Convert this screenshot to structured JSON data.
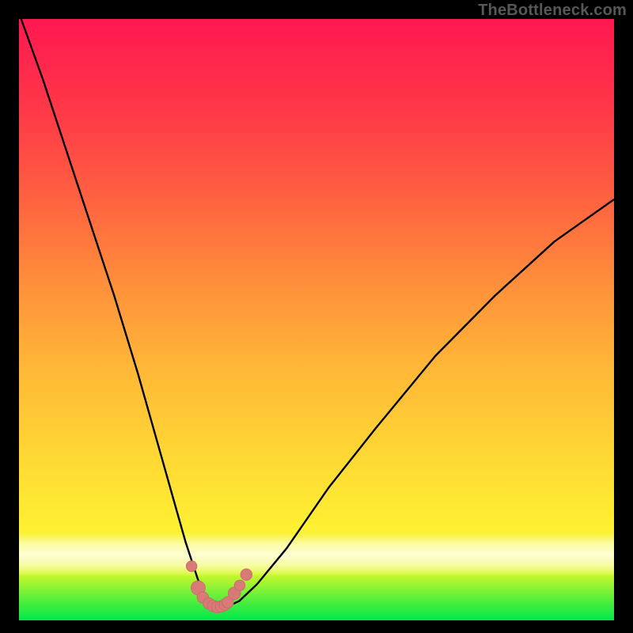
{
  "watermark": "TheBottleneck.com",
  "chart_data": {
    "type": "line",
    "title": "",
    "xlabel": "",
    "ylabel": "",
    "xlim": [
      0,
      100
    ],
    "ylim": [
      0,
      100
    ],
    "series": [
      {
        "name": "bottleneck-curve",
        "x": [
          0,
          4,
          8,
          12,
          16,
          20,
          24,
          26,
          28,
          30,
          31,
          32,
          33,
          34,
          35,
          37,
          40,
          45,
          52,
          60,
          70,
          80,
          90,
          100
        ],
        "y": [
          101,
          90,
          78,
          66,
          54,
          41,
          27,
          20,
          13,
          7,
          4.5,
          3,
          2.3,
          2.1,
          2.3,
          3.2,
          6,
          12,
          22,
          32,
          44,
          54,
          63,
          70
        ]
      }
    ],
    "markers": {
      "x": [
        29.0,
        30.1,
        30.9,
        31.9,
        32.6,
        33.3,
        34.0,
        34.6,
        35.1,
        36.2,
        37.1,
        38.2
      ],
      "y": [
        9.0,
        5.4,
        3.8,
        2.8,
        2.4,
        2.2,
        2.3,
        2.6,
        3.0,
        4.5,
        5.8,
        7.6
      ],
      "r": [
        1.2,
        1.6,
        1.3,
        1.3,
        1.3,
        1.3,
        1.3,
        1.3,
        1.3,
        1.4,
        1.2,
        1.3
      ]
    },
    "gradient_stops": [
      {
        "pct": 0,
        "color": "#00e84c"
      },
      {
        "pct": 15,
        "color": "#fef132"
      },
      {
        "pct": 55,
        "color": "#ff8f3b"
      },
      {
        "pct": 100,
        "color": "#ff1850"
      }
    ]
  }
}
